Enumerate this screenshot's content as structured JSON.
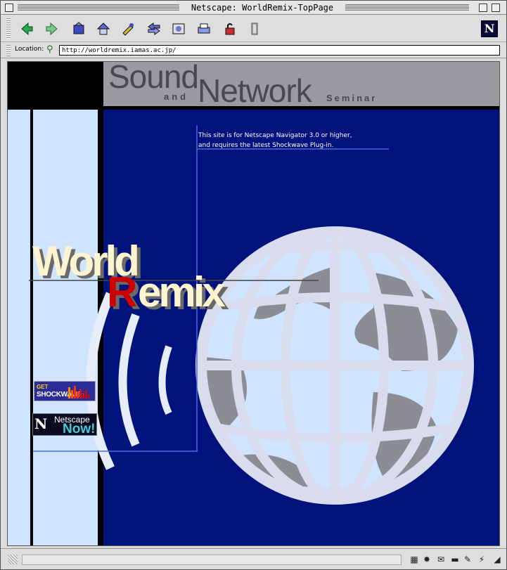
{
  "window": {
    "title": "Netscape: WorldRemix-TopPage"
  },
  "toolbar": {
    "buttons": [
      {
        "name": "back-icon",
        "glyph": "◀"
      },
      {
        "name": "forward-icon",
        "glyph": "▶"
      },
      {
        "name": "reload-icon",
        "glyph": "↻"
      },
      {
        "name": "home-icon",
        "glyph": "⌂"
      },
      {
        "name": "search-icon",
        "glyph": "✎"
      },
      {
        "name": "guide-icon",
        "glyph": "⇆"
      },
      {
        "name": "images-icon",
        "glyph": "▦"
      },
      {
        "name": "print-icon",
        "glyph": "⎙"
      },
      {
        "name": "security-icon",
        "glyph": "🔓"
      },
      {
        "name": "stop-icon",
        "glyph": "▮"
      }
    ],
    "logo": "N"
  },
  "location": {
    "label": "Location:",
    "url": "http://worldremix.iamas.ac.jp/"
  },
  "page": {
    "header": {
      "sound": "Sound",
      "and": "and",
      "network": "Network",
      "seminar": "Seminar"
    },
    "info_line1": "This site is for Netscape Navigator 3.0 or higher,",
    "info_line2": "and requires the latest Shockwave Plug-in.",
    "logo_world": "World",
    "logo_r": "R",
    "logo_emix": "emix",
    "shockwave_badge": {
      "line1": "GET",
      "line2": "SHOCKWAVE"
    },
    "netscape_badge": {
      "mark": "N",
      "line1": "Netscape",
      "line2": "Now!"
    }
  },
  "colors": {
    "page_blue": "#00127c",
    "light_blue": "#cfe5ff",
    "header_gray": "#9a9aa0",
    "globe_fill": "#cfe5ff",
    "land_gray": "#8c8c94",
    "remix_r": "#cc0000",
    "logo_cream": "#fff4d0"
  },
  "status": {
    "text": ""
  }
}
